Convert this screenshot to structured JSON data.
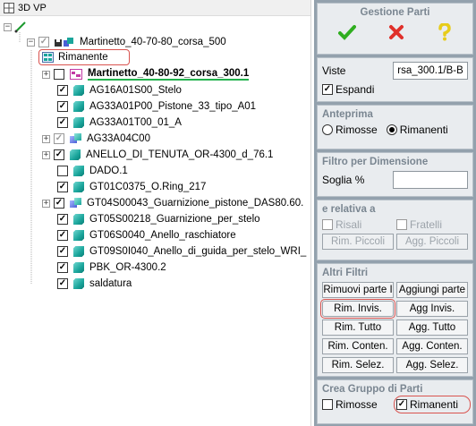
{
  "header": {
    "title": "3D VP"
  },
  "tree": {
    "rows": [
      {
        "label": "Martinetto_40-70-80_corsa_500"
      },
      {
        "label": "Rimanente"
      },
      {
        "label": "Martinetto_40-80-92_corsa_300.1"
      },
      {
        "label": "AG16A01S00_Stelo"
      },
      {
        "label": "AG33A01P00_Pistone_33_tipo_A01"
      },
      {
        "label": "AG33A01T00_01_A"
      },
      {
        "label": "AG33A04C00"
      },
      {
        "label": "ANELLO_DI_TENUTA_OR-4300_d_76.1"
      },
      {
        "label": "DADO.1"
      },
      {
        "label": "GT01C0375_O.Ring_217"
      },
      {
        "label": "GT04S00043_Guarnizione_pistone_DAS80.60."
      },
      {
        "label": "GT05S00218_Guarnizione_per_stelo"
      },
      {
        "label": "GT06S0040_Anello_raschiatore"
      },
      {
        "label": "GT09S0I040_Anello_di_guida_per_stelo_WRI_"
      },
      {
        "label": "PBK_OR-4300.2"
      },
      {
        "label": "saldatura"
      }
    ]
  },
  "panel": {
    "title": "Gestione Parti",
    "viste": {
      "label": "Viste",
      "value": "rsa_300.1/B-B"
    },
    "espandi": {
      "label": "Espandi",
      "checked": true
    },
    "anteprima": {
      "title": "Anteprima",
      "rimosse": "Rimosse",
      "rimanenti": "Rimanenti"
    },
    "filtro": {
      "title": "Filtro per Dimensione",
      "soglia": "Soglia %",
      "value": ""
    },
    "relativa": {
      "title": "e relativa a",
      "risali": "Risali",
      "fratelli": "Fratelli",
      "rim_piccoli": "Rim. Piccoli",
      "agg_piccoli": "Agg. Piccoli"
    },
    "altri": {
      "title": "Altri Filtri",
      "buttons": [
        "Rimuovi parte I",
        "Aggiungi parte",
        "Rim. Invis.",
        "Agg Invis.",
        "Rim. Tutto",
        "Agg. Tutto",
        "Rim. Conten.",
        "Agg. Conten.",
        "Rim. Selez.",
        "Agg. Selez."
      ]
    },
    "crea": {
      "title": "Crea Gruppo di Parti",
      "rimosse": "Rimosse",
      "rimanenti": "Rimanenti"
    }
  },
  "colors": {
    "accept": "#2fae1f",
    "cancel": "#e0302a",
    "help": "#e7cc1a",
    "panel_bg": "#93a1ad",
    "highlight": "#d9534f",
    "underline_green": "#22b24c"
  }
}
